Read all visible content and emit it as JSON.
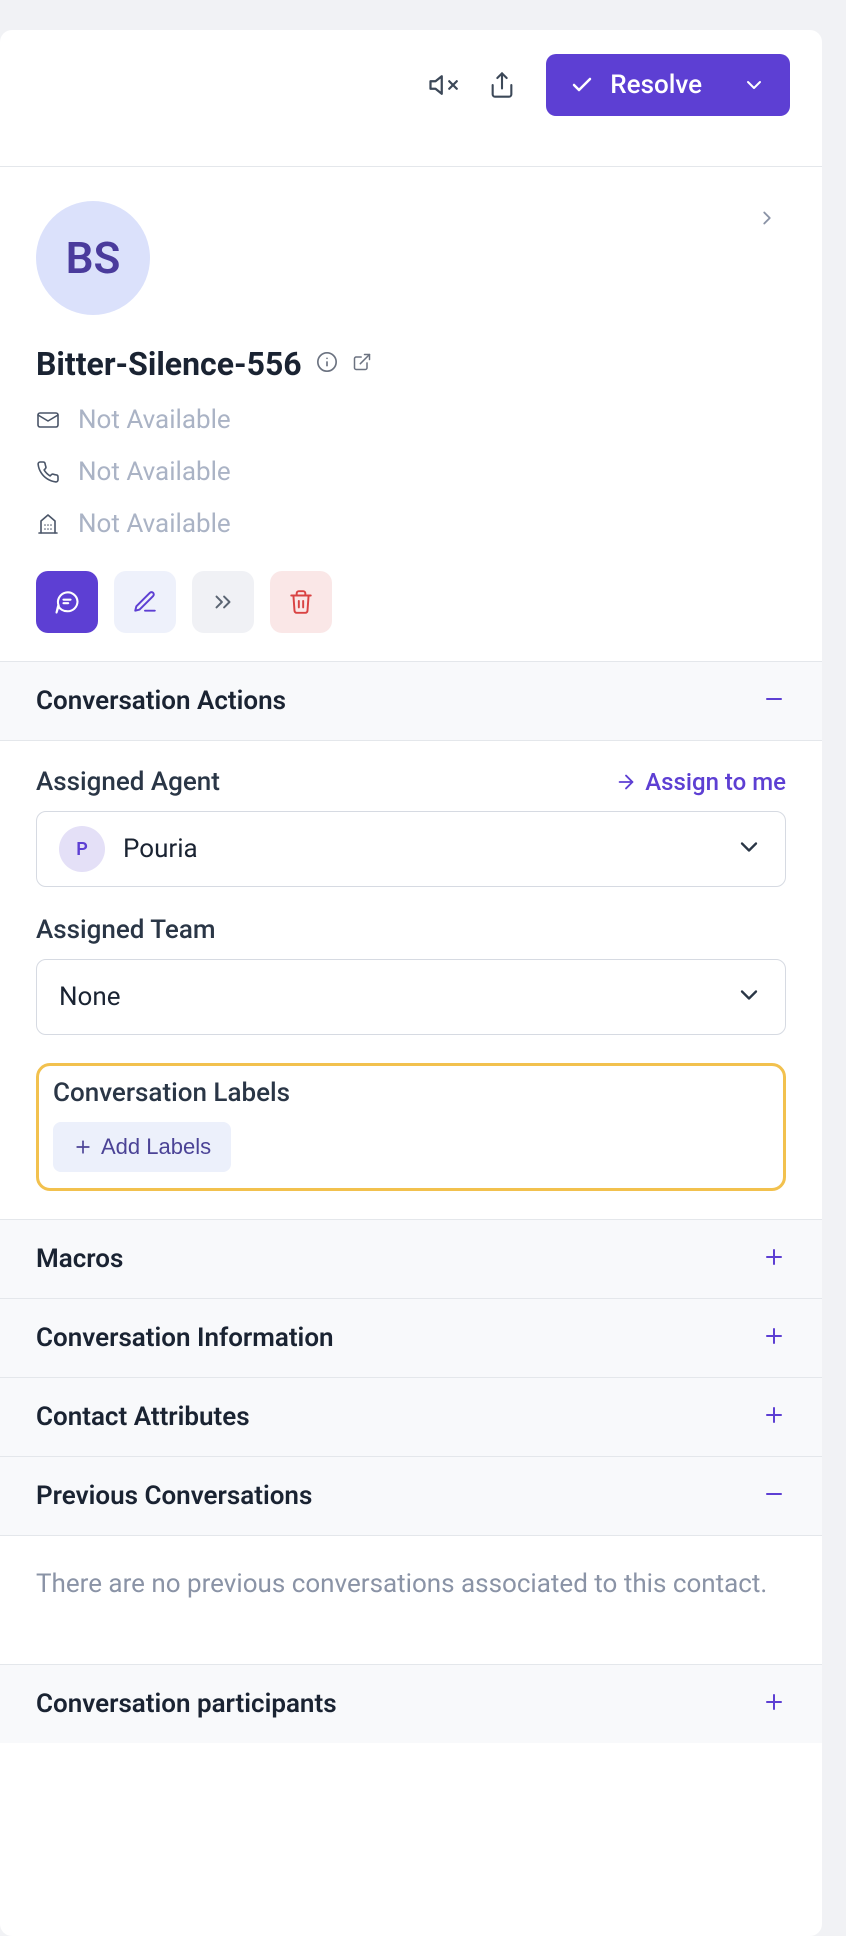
{
  "toolbar": {
    "resolve_label": "Resolve"
  },
  "contact": {
    "avatar_initials": "BS",
    "name": "Bitter-Silence-556",
    "email": "Not Available",
    "phone": "Not Available",
    "company": "Not Available"
  },
  "sections": {
    "conversation_actions_title": "Conversation Actions",
    "assigned_agent_label": "Assigned Agent",
    "assign_to_me_label": "Assign to me",
    "agent_value": "Pouria",
    "agent_initial": "P",
    "assigned_team_label": "Assigned Team",
    "team_value": "None",
    "conversation_labels_title": "Conversation Labels",
    "add_labels_label": "Add Labels",
    "macros_title": "Macros",
    "conversation_information_title": "Conversation Information",
    "contact_attributes_title": "Contact Attributes",
    "previous_conversations_title": "Previous Conversations",
    "previous_conversations_empty": "There are no previous conversations associated to this contact.",
    "participants_title": "Conversation participants"
  }
}
